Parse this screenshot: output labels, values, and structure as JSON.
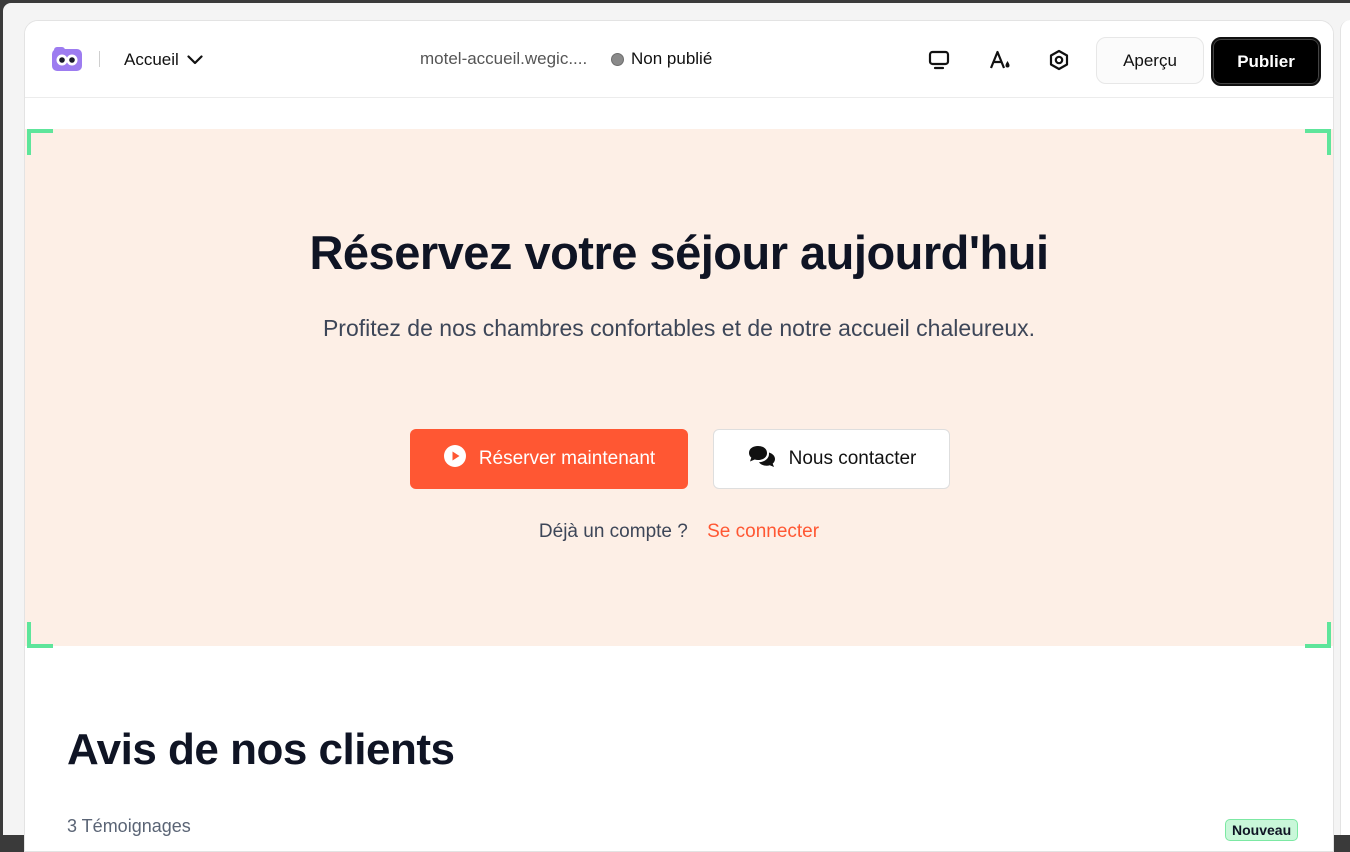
{
  "toolbar": {
    "page_name": "Accueil",
    "site_url": "motel-accueil.wegic....",
    "status": "Non publié",
    "preview_label": "Aperçu",
    "publish_label": "Publier"
  },
  "hero": {
    "title": "Réservez votre séjour aujourd'hui",
    "subtitle": "Profitez de nos chambres confortables et de notre accueil chaleureux.",
    "primary_button": "Réserver maintenant",
    "secondary_button": "Nous contacter",
    "account_question": "Déjà un compte ?",
    "login_link": "Se connecter"
  },
  "reviews": {
    "title": "Avis de nos clients",
    "count": "3 Témoignages",
    "badge": "Nouveau"
  },
  "icons": {
    "logo": "owl-logo-icon",
    "page_dropdown": "chevron-down-icon",
    "device": "monitor-icon",
    "theme": "font-color-icon",
    "settings": "settings-hexagon-icon",
    "book": "play-circle-icon",
    "contact": "chat-bubbles-icon"
  },
  "colors": {
    "accent": "#ff5733",
    "hero_bg": "#fdefe6",
    "selection": "#5ee59b",
    "heading": "#0f1424"
  }
}
